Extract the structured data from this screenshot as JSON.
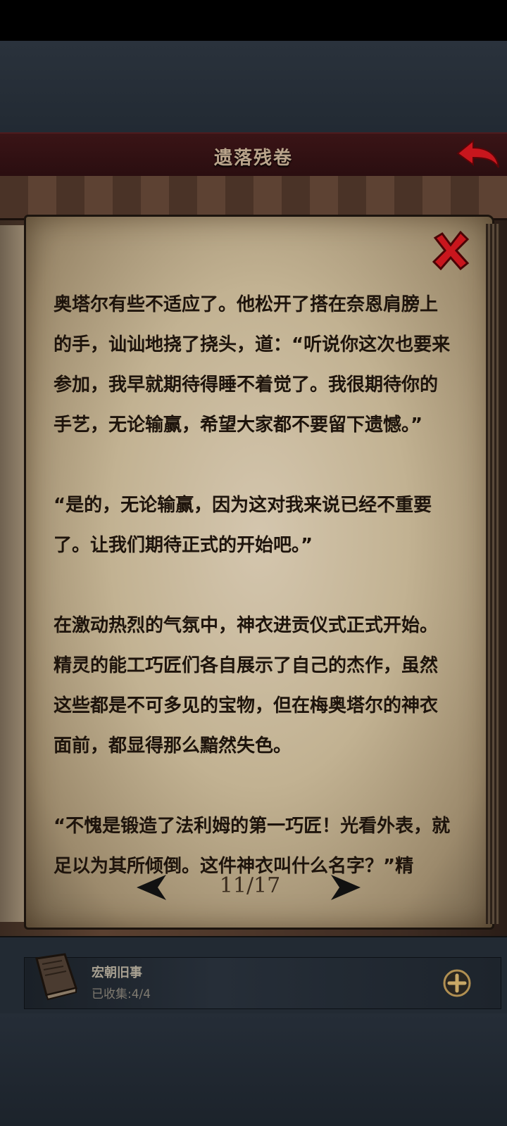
{
  "header": {
    "title": "遗落残卷",
    "back_icon": "back-arrow-icon"
  },
  "reader": {
    "close_icon": "close-x-icon",
    "paragraphs": [
      "奥塔尔有些不适应了。他松开了搭在奈恩肩膀上的手，讪讪地挠了挠头，道：“听说你这次也要来参加，我早就期待得睡不着觉了。我很期待你的手艺，无论输赢，希望大家都不要留下遗憾。”",
      "“是的，无论输赢，因为这对我来说已经不重要了。让我们期待正式的开始吧。”",
      "在激动热烈的气氛中，神衣进贡仪式正式开始。精灵的能工巧匠们各自展示了自己的杰作，虽然这些都是不可多见的宝物，但在梅奥塔尔的神衣面前，都显得那么黯然失色。",
      "“不愧是锻造了法利姆的第一巧匠！光看外表，就足以为其所倾倒。这件神衣叫什么名字？”精"
    ],
    "pager": {
      "current_page": 11,
      "total_pages": 17,
      "label": "11/17",
      "prev_icon": "arrow-left-icon",
      "next_icon": "arrow-right-icon"
    }
  },
  "collection": {
    "name": "宏朝旧事",
    "progress_label": "已收集:",
    "progress_value": "4/4",
    "icon": "book-icon",
    "add_icon": "plus-icon"
  },
  "colors": {
    "title_bar": "#3a1416",
    "accent_red": "#c8161d",
    "parchment": "#c2b292",
    "text": "#1e140c"
  }
}
